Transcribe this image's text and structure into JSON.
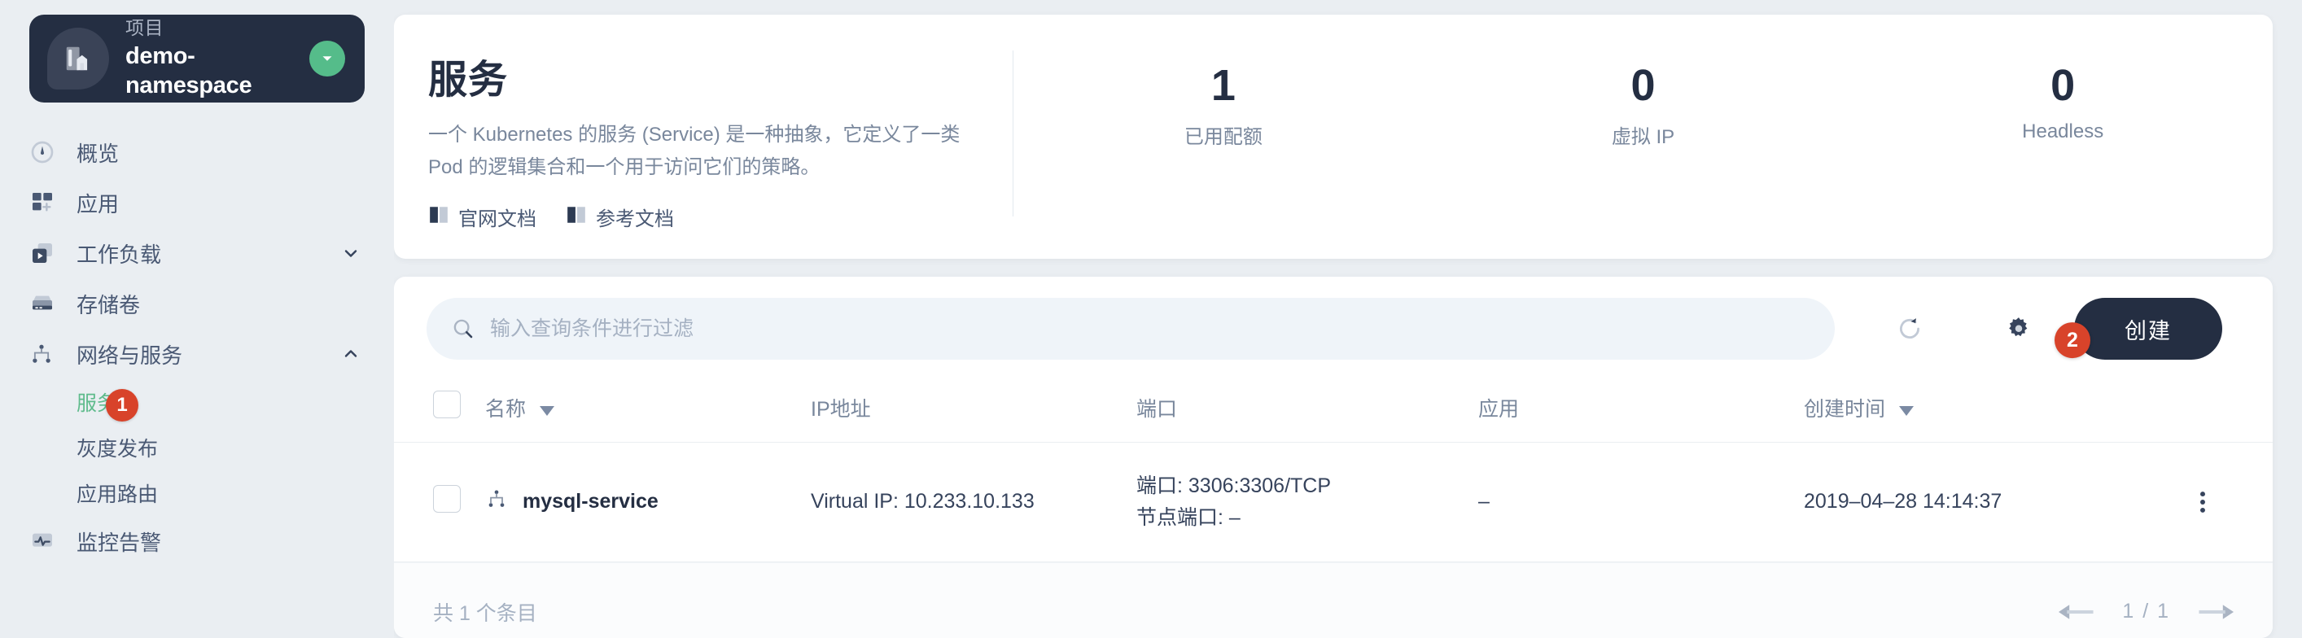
{
  "sidebar": {
    "project": {
      "kind_label": "项目",
      "name": "demo-namespace",
      "logo_icon": "project-logo-icon",
      "switch_icon": "chevron-down-circle-icon"
    },
    "items": [
      {
        "label": "概览",
        "icon": "dashboard-icon",
        "expandable": false
      },
      {
        "label": "应用",
        "icon": "apps-grid-icon",
        "expandable": false
      },
      {
        "label": "工作负载",
        "icon": "workload-icon",
        "expandable": true,
        "expanded": false
      },
      {
        "label": "存储卷",
        "icon": "storage-volume-icon",
        "expandable": false
      },
      {
        "label": "网络与服务",
        "icon": "network-topology-icon",
        "expandable": true,
        "expanded": true
      },
      {
        "label": "监控告警",
        "icon": "monitoring-alert-icon",
        "expandable": false
      }
    ],
    "subitems": [
      {
        "label": "服务",
        "active": true,
        "badge": "1"
      },
      {
        "label": "灰度发布",
        "active": false,
        "badge": ""
      },
      {
        "label": "应用路由",
        "active": false,
        "badge": ""
      }
    ]
  },
  "banner": {
    "title": "服务",
    "description": "一个 Kubernetes 的服务 (Service) 是一种抽象，它定义了一类 Pod 的逻辑集合和一个用于访问它们的策略。",
    "links": [
      {
        "label": "官网文档",
        "icon": "book-icon"
      },
      {
        "label": "参考文档",
        "icon": "book-icon"
      }
    ],
    "stats": [
      {
        "value": "1",
        "label": "已用配额"
      },
      {
        "value": "0",
        "label": "虚拟 IP"
      },
      {
        "value": "0",
        "label": "Headless"
      }
    ]
  },
  "toolbar": {
    "search_placeholder": "输入查询条件进行过滤",
    "search_value": "",
    "search_icon": "search-icon",
    "refresh_icon": "refresh-icon",
    "settings_icon": "gear-icon",
    "create_label": "创建",
    "create_badge": "2"
  },
  "table": {
    "columns": [
      {
        "key": "check",
        "label": ""
      },
      {
        "key": "name",
        "label": "名称",
        "sortable": true,
        "sort_icon": "caret-down-icon"
      },
      {
        "key": "ip",
        "label": "IP地址",
        "sortable": false
      },
      {
        "key": "port",
        "label": "端口",
        "sortable": false
      },
      {
        "key": "app",
        "label": "应用",
        "sortable": false
      },
      {
        "key": "time",
        "label": "创建时间",
        "sortable": true,
        "sort_icon": "caret-down-icon"
      },
      {
        "key": "more",
        "label": ""
      }
    ],
    "rows": [
      {
        "name": "mysql-service",
        "name_icon": "service-node-icon",
        "ip": "Virtual IP: 10.233.10.133",
        "port_main": "端口: 3306:3306/TCP",
        "port_node": "节点端口: –",
        "app": "–",
        "time": "2019–04–28 14:14:37",
        "more_icon": "more-vertical-icon"
      }
    ]
  },
  "footer": {
    "total_text": "共 1 个条目",
    "prev_icon": "arrow-left-icon",
    "next_icon": "arrow-right-icon",
    "page_text": "1 / 1"
  },
  "colors": {
    "dark": "#242e42",
    "accent_green": "#55bc8a",
    "badge_red": "#d8432a",
    "body_bg": "#eaeef2",
    "muted_text": "#79879c"
  }
}
